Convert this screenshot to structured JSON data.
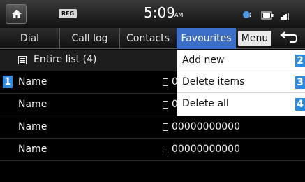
{
  "status": {
    "reg_badge": "REG",
    "time": "5:09",
    "ampm": "AM"
  },
  "tabs": [
    {
      "label": "Dial"
    },
    {
      "label": "Call log"
    },
    {
      "label": "Contacts"
    },
    {
      "label": "Favourites",
      "active": true
    }
  ],
  "menu_label": "Menu",
  "list": {
    "title": "Entire list (4)",
    "items": [
      {
        "name": "Name",
        "number": "00000000000"
      },
      {
        "name": "Name",
        "number": "00000000000"
      },
      {
        "name": "Name",
        "number": "00000000000"
      },
      {
        "name": "Name",
        "number": "00000000000"
      }
    ]
  },
  "dropdown": [
    {
      "label": "Add new",
      "badge": "2"
    },
    {
      "label": "Delete items",
      "badge": "3"
    },
    {
      "label": "Delete all",
      "badge": "4"
    }
  ],
  "callout_row": "1",
  "colors": {
    "accent": "#3b6ec8",
    "callout": "#2a8be0"
  }
}
